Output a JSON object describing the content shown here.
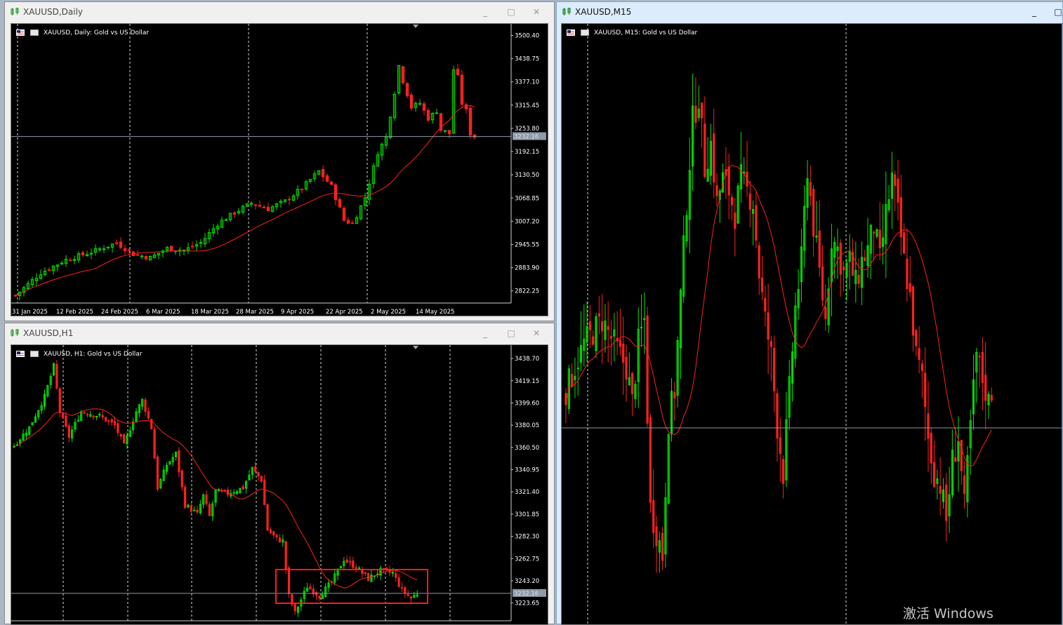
{
  "windows": [
    {
      "title": "XAUUSD,Daily",
      "active": false,
      "chart_title": "XAUUSD, Daily:  Gold vs US Dollar",
      "price_labels": [
        "3500.40",
        "3438.75",
        "3377.10",
        "3315.45",
        "3253.80",
        "3192.15",
        "3130.50",
        "3068.85",
        "3007.20",
        "2945.55",
        "2883.90",
        "2822.25"
      ],
      "current_price": "3232.16",
      "date_labels": [
        "31 Jan 2025",
        "12 Feb 2025",
        "24 Feb 2025",
        "6 Mar 2025",
        "18 Mar 2025",
        "28 Mar 2025",
        "9 Apr 2025",
        "22 Apr 2025",
        "2 May 2025",
        "14 May 2025"
      ]
    },
    {
      "title": "XAUUSD,H1",
      "active": false,
      "chart_title": "XAUUSD, H1:  Gold vs US Dollar",
      "price_labels": [
        "3438.70",
        "3419.15",
        "3399.60",
        "3380.05",
        "3360.50",
        "3340.95",
        "3321.40",
        "3301.85",
        "3282.30",
        "3262.75",
        "3243.20",
        "3223.65"
      ],
      "current_price": "3232.16"
    },
    {
      "title": "XAUUSD,M15",
      "active": true,
      "chart_title": "XAUUSD, M15:  Gold vs US Dollar"
    }
  ],
  "window_buttons": {
    "minimize": "_",
    "maximize": "□",
    "close": "✕"
  },
  "watermark": "激活 Windows",
  "colors": {
    "bull": "#00e400",
    "bear": "#ff2020",
    "ma": "#ff2020",
    "grid": "#ffffff",
    "price_line": "#8e9aa8",
    "highlight_box": "#ff1a1a"
  },
  "chart_data": [
    {
      "type": "candlestick",
      "symbol": "XAUUSD",
      "timeframe": "Daily",
      "title": "XAUUSD, Daily:  Gold vs US Dollar",
      "ylim": [
        2790,
        3520
      ],
      "indicator": "moving average (red)",
      "last_price": 3232.16,
      "close_path": [
        [
          0,
          2810
        ],
        [
          6,
          2870
        ],
        [
          12,
          2905
        ],
        [
          18,
          2925
        ],
        [
          24,
          2950
        ],
        [
          28,
          2920
        ],
        [
          32,
          2910
        ],
        [
          36,
          2935
        ],
        [
          40,
          2930
        ],
        [
          44,
          2950
        ],
        [
          48,
          3000
        ],
        [
          52,
          3030
        ],
        [
          56,
          3055
        ],
        [
          60,
          3040
        ],
        [
          64,
          3060
        ],
        [
          68,
          3095
        ],
        [
          72,
          3140
        ],
        [
          75,
          3100
        ],
        [
          78,
          3010
        ],
        [
          80,
          3000
        ],
        [
          83,
          3070
        ],
        [
          86,
          3190
        ],
        [
          88,
          3230
        ],
        [
          90,
          3350
        ],
        [
          91,
          3420
        ],
        [
          92,
          3380
        ],
        [
          94,
          3310
        ],
        [
          96,
          3320
        ],
        [
          98,
          3280
        ],
        [
          100,
          3300
        ],
        [
          101,
          3250
        ],
        [
          103,
          3240
        ],
        [
          104,
          3410
        ],
        [
          105,
          3390
        ],
        [
          106,
          3320
        ],
        [
          107,
          3300
        ],
        [
          108,
          3240
        ],
        [
          109,
          3232
        ]
      ]
    },
    {
      "type": "candlestick",
      "symbol": "XAUUSD",
      "timeframe": "H1",
      "title": "XAUUSD, H1:  Gold vs US Dollar",
      "ylim": [
        3208,
        3448
      ],
      "indicator": "moving average (red)",
      "last_price": 3232.16,
      "close_path": [
        [
          0,
          3362
        ],
        [
          5,
          3378
        ],
        [
          10,
          3405
        ],
        [
          13,
          3432
        ],
        [
          15,
          3392
        ],
        [
          18,
          3370
        ],
        [
          22,
          3392
        ],
        [
          28,
          3388
        ],
        [
          33,
          3380
        ],
        [
          36,
          3362
        ],
        [
          40,
          3392
        ],
        [
          42,
          3402
        ],
        [
          45,
          3378
        ],
        [
          47,
          3325
        ],
        [
          50,
          3345
        ],
        [
          53,
          3355
        ],
        [
          56,
          3310
        ],
        [
          60,
          3302
        ],
        [
          62,
          3318
        ],
        [
          64,
          3300
        ],
        [
          66,
          3322
        ],
        [
          70,
          3320
        ],
        [
          75,
          3325
        ],
        [
          78,
          3342
        ],
        [
          81,
          3332
        ],
        [
          83,
          3288
        ],
        [
          86,
          3280
        ],
        [
          88,
          3278
        ],
        [
          90,
          3230
        ],
        [
          92,
          3215
        ],
        [
          96,
          3238
        ],
        [
          100,
          3230
        ],
        [
          104,
          3242
        ],
        [
          108,
          3262
        ],
        [
          112,
          3255
        ],
        [
          116,
          3245
        ],
        [
          120,
          3252
        ],
        [
          124,
          3250
        ],
        [
          127,
          3235
        ],
        [
          130,
          3228
        ],
        [
          132,
          3232
        ]
      ]
    },
    {
      "type": "candlestick",
      "symbol": "XAUUSD",
      "timeframe": "M15",
      "title": "XAUUSD, M15:  Gold vs US Dollar",
      "ylim": [
        0,
        100
      ],
      "indicator": "moving average (red)",
      "close_path": [
        [
          0,
          40
        ],
        [
          6,
          48
        ],
        [
          12,
          52
        ],
        [
          16,
          48
        ],
        [
          20,
          44
        ],
        [
          22,
          38
        ],
        [
          24,
          48
        ],
        [
          26,
          52
        ],
        [
          28,
          20
        ],
        [
          32,
          12
        ],
        [
          34,
          35
        ],
        [
          36,
          40
        ],
        [
          38,
          56
        ],
        [
          40,
          72
        ],
        [
          42,
          86
        ],
        [
          44,
          90
        ],
        [
          46,
          78
        ],
        [
          48,
          82
        ],
        [
          50,
          72
        ],
        [
          52,
          76
        ],
        [
          54,
          74
        ],
        [
          56,
          70
        ],
        [
          58,
          76
        ],
        [
          60,
          74
        ],
        [
          62,
          72
        ],
        [
          64,
          60
        ],
        [
          66,
          52
        ],
        [
          68,
          46
        ],
        [
          70,
          34
        ],
        [
          72,
          26
        ],
        [
          74,
          40
        ],
        [
          76,
          54
        ],
        [
          78,
          62
        ],
        [
          80,
          78
        ],
        [
          82,
          68
        ],
        [
          84,
          60
        ],
        [
          86,
          52
        ],
        [
          88,
          66
        ],
        [
          90,
          64
        ],
        [
          92,
          60
        ],
        [
          94,
          62
        ],
        [
          96,
          58
        ],
        [
          98,
          62
        ],
        [
          100,
          64
        ],
        [
          102,
          68
        ],
        [
          104,
          62
        ],
        [
          106,
          70
        ],
        [
          108,
          76
        ],
        [
          110,
          70
        ],
        [
          112,
          62
        ],
        [
          114,
          56
        ],
        [
          116,
          46
        ],
        [
          118,
          42
        ],
        [
          120,
          32
        ],
        [
          122,
          26
        ],
        [
          124,
          24
        ],
        [
          126,
          18
        ],
        [
          128,
          28
        ],
        [
          130,
          32
        ],
        [
          132,
          20
        ],
        [
          134,
          34
        ],
        [
          136,
          46
        ],
        [
          138,
          42
        ],
        [
          140,
          38
        ],
        [
          141,
          40
        ]
      ]
    }
  ]
}
